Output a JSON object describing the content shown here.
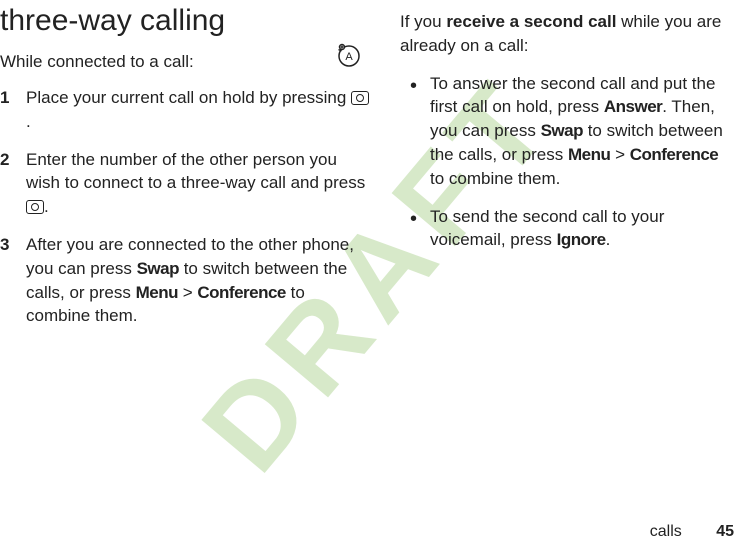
{
  "watermark": "DRAFT",
  "left": {
    "heading": "three-way calling",
    "intro": "While connected to a call:",
    "steps": [
      {
        "pre": "Place your current call on hold by pressing ",
        "post": "."
      },
      {
        "pre": "Enter the number of the other person you wish to connect to a three-way call and press ",
        "post": "."
      },
      {
        "pre": "After you are connected to the other phone, you can press ",
        "swap": "Swap",
        "mid1": " to switch between the calls, or press ",
        "menu": "Menu",
        "gt": " > ",
        "conf": "Conference",
        "post": " to combine them."
      }
    ]
  },
  "right": {
    "intro_pre": "If you ",
    "intro_bold": "receive a second call",
    "intro_post": " while you are already on a call:",
    "bullets": [
      {
        "t1": "To answer the second call and put the first call on hold, press ",
        "answer": "Answer",
        "t2": ". Then, you can press ",
        "swap": "Swap",
        "t3": " to switch between the calls, or press ",
        "menu": "Menu",
        "gt": " > ",
        "conf": "Conference",
        "t4": " to combine them."
      },
      {
        "t1": "To send the second call to your voicemail, press ",
        "ignore": "Ignore",
        "t2": "."
      }
    ]
  },
  "footer": {
    "section": "calls",
    "page": "45"
  }
}
